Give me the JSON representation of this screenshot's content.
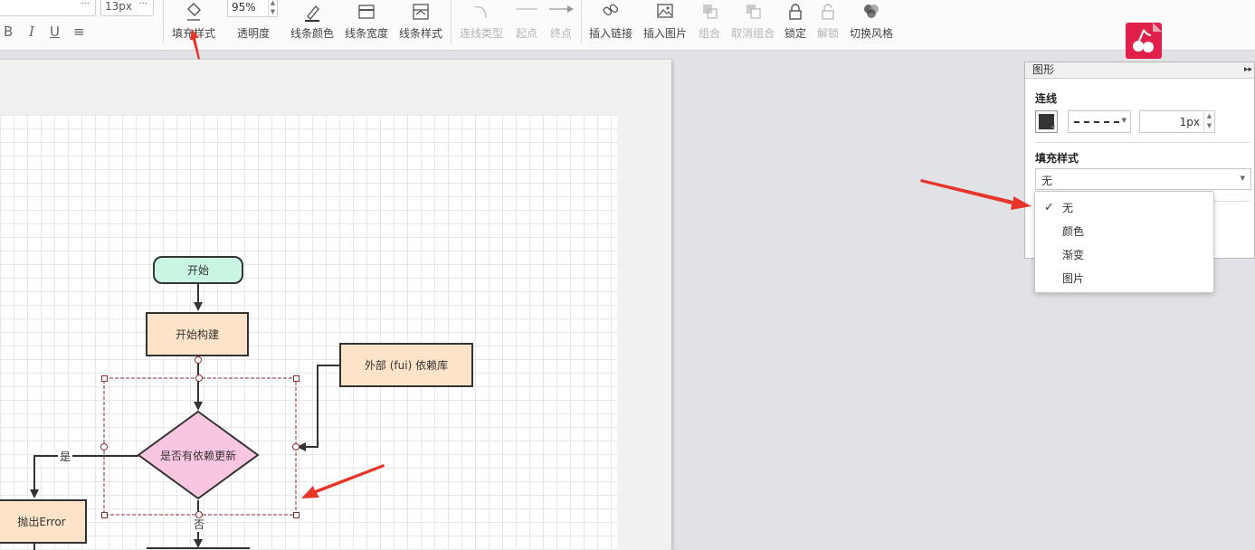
{
  "toolbar": {
    "font_family_value": "",
    "font_family_more": "···",
    "font_size_value": "13px",
    "font_size_more": "···",
    "format_bold": "B",
    "format_italic": "I",
    "format_underline": "U",
    "format_align": "≡",
    "fill_style_label": "填充样式",
    "opacity_value": "95%",
    "opacity_label": "透明度",
    "line_color_label": "线条颜色",
    "line_width_label": "线条宽度",
    "line_style_label": "线条样式",
    "connector_type_label": "连线类型",
    "start_label": "起点",
    "end_label": "终点",
    "insert_link_label": "插入链接",
    "insert_image_label": "插入图片",
    "group_label": "组合",
    "ungroup_label": "取消组合",
    "lock_label": "锁定",
    "unlock_label": "解锁",
    "switch_theme_label": "切换风格"
  },
  "canvas": {
    "nodes": {
      "start": "开始",
      "start_build": "开始构建",
      "external_deps": "外部 (fui) 依赖库",
      "decision": "是否有依赖更新",
      "throw_error": "抛出Error"
    },
    "edge_labels": {
      "yes": "是",
      "no": "否"
    },
    "colors": {
      "start_fill": "#c9f6e3",
      "process_fill": "#fde3c8",
      "decision_fill": "#f9c6e1",
      "selection": "#8b2c2c",
      "annotation_arrow": "#e8352a"
    }
  },
  "panel": {
    "title": "图形",
    "collapse_icon": "▸▸",
    "line_section_title": "连线",
    "line_color_hex": "#333333",
    "line_width_value": "1px",
    "fill_section_title": "填充样式",
    "fill_selected": "无"
  },
  "dropdown": {
    "items": [
      {
        "label": "无",
        "checked": true
      },
      {
        "label": "颜色",
        "checked": false
      },
      {
        "label": "渐变",
        "checked": false
      },
      {
        "label": "图片",
        "checked": false
      }
    ],
    "check_glyph": "✓"
  },
  "logo": {
    "color": "#e0204b"
  }
}
